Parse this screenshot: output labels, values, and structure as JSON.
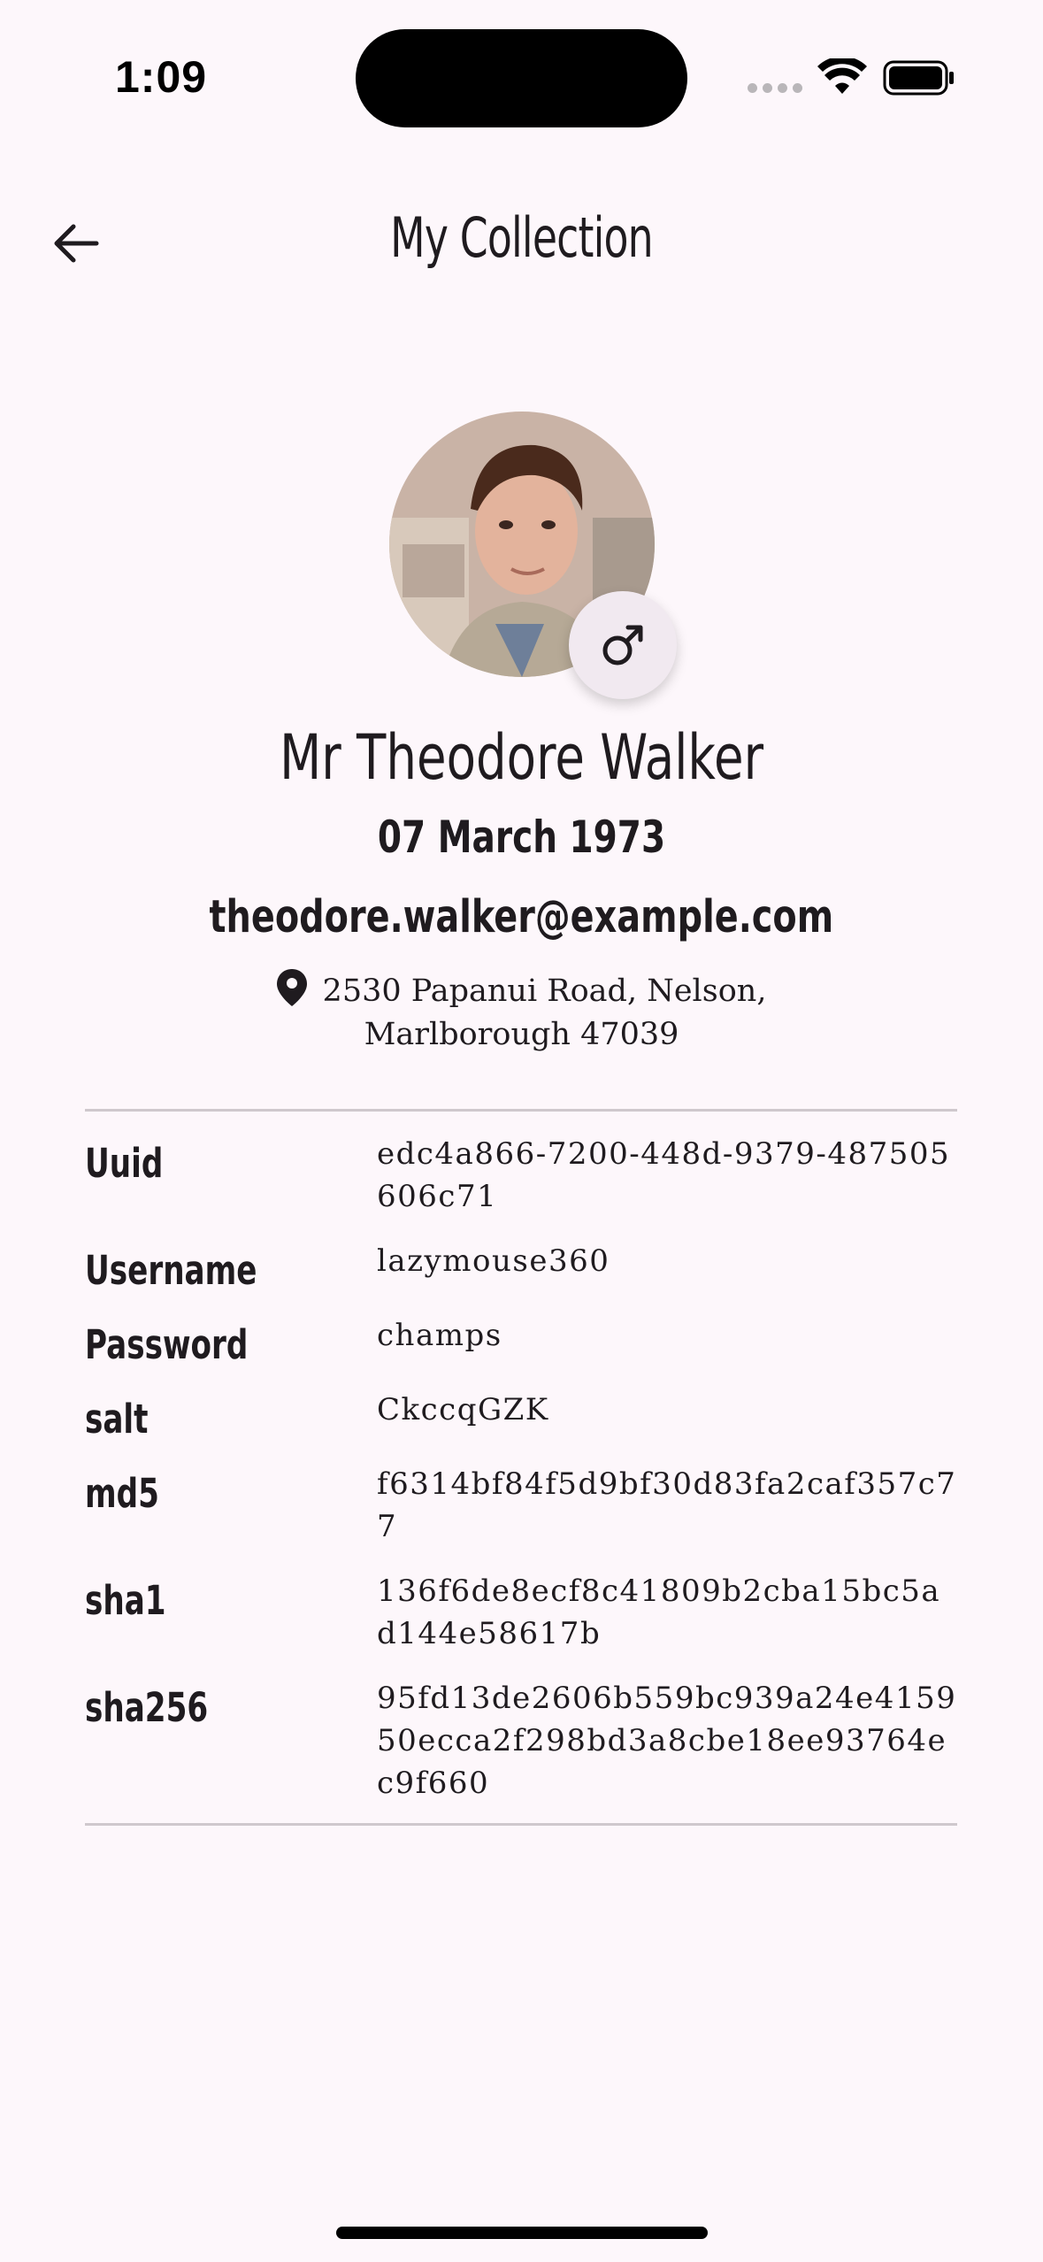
{
  "status_bar": {
    "time": "1:09",
    "wifi_icon": "wifi-icon",
    "battery_icon": "battery-icon"
  },
  "header": {
    "title": "My Collection",
    "back_icon": "arrow-left-icon"
  },
  "profile": {
    "gender_icon": "male-icon",
    "name": "Mr Theodore Walker",
    "dob": "07 March 1973",
    "email": "theodore.walker@example.com",
    "address_line1": "2530 Papanui Road, Nelson,",
    "address_line2": "Marlborough 47039",
    "location_icon": "location-pin-icon"
  },
  "details": [
    {
      "label": "Uuid",
      "value": "edc4a866-7200-448d-9379-487505606c71"
    },
    {
      "label": "Username",
      "value": "lazymouse360"
    },
    {
      "label": "Password",
      "value": "champs"
    },
    {
      "label": "salt",
      "value": "CkccqGZK"
    },
    {
      "label": "md5",
      "value": "f6314bf84f5d9bf30d83fa2caf357c77"
    },
    {
      "label": "sha1",
      "value": "136f6de8ecf8c41809b2cba15bc5ad144e58617b"
    },
    {
      "label": "sha256",
      "value": "95fd13de2606b559bc939a24e415950ecca2f298bd3a8cbe18ee93764ec9f660"
    }
  ],
  "colors": {
    "background": "#fdf7fb",
    "text": "#1f1b1f",
    "divider": "#cfc8cd",
    "badge": "#f1e9f0"
  }
}
